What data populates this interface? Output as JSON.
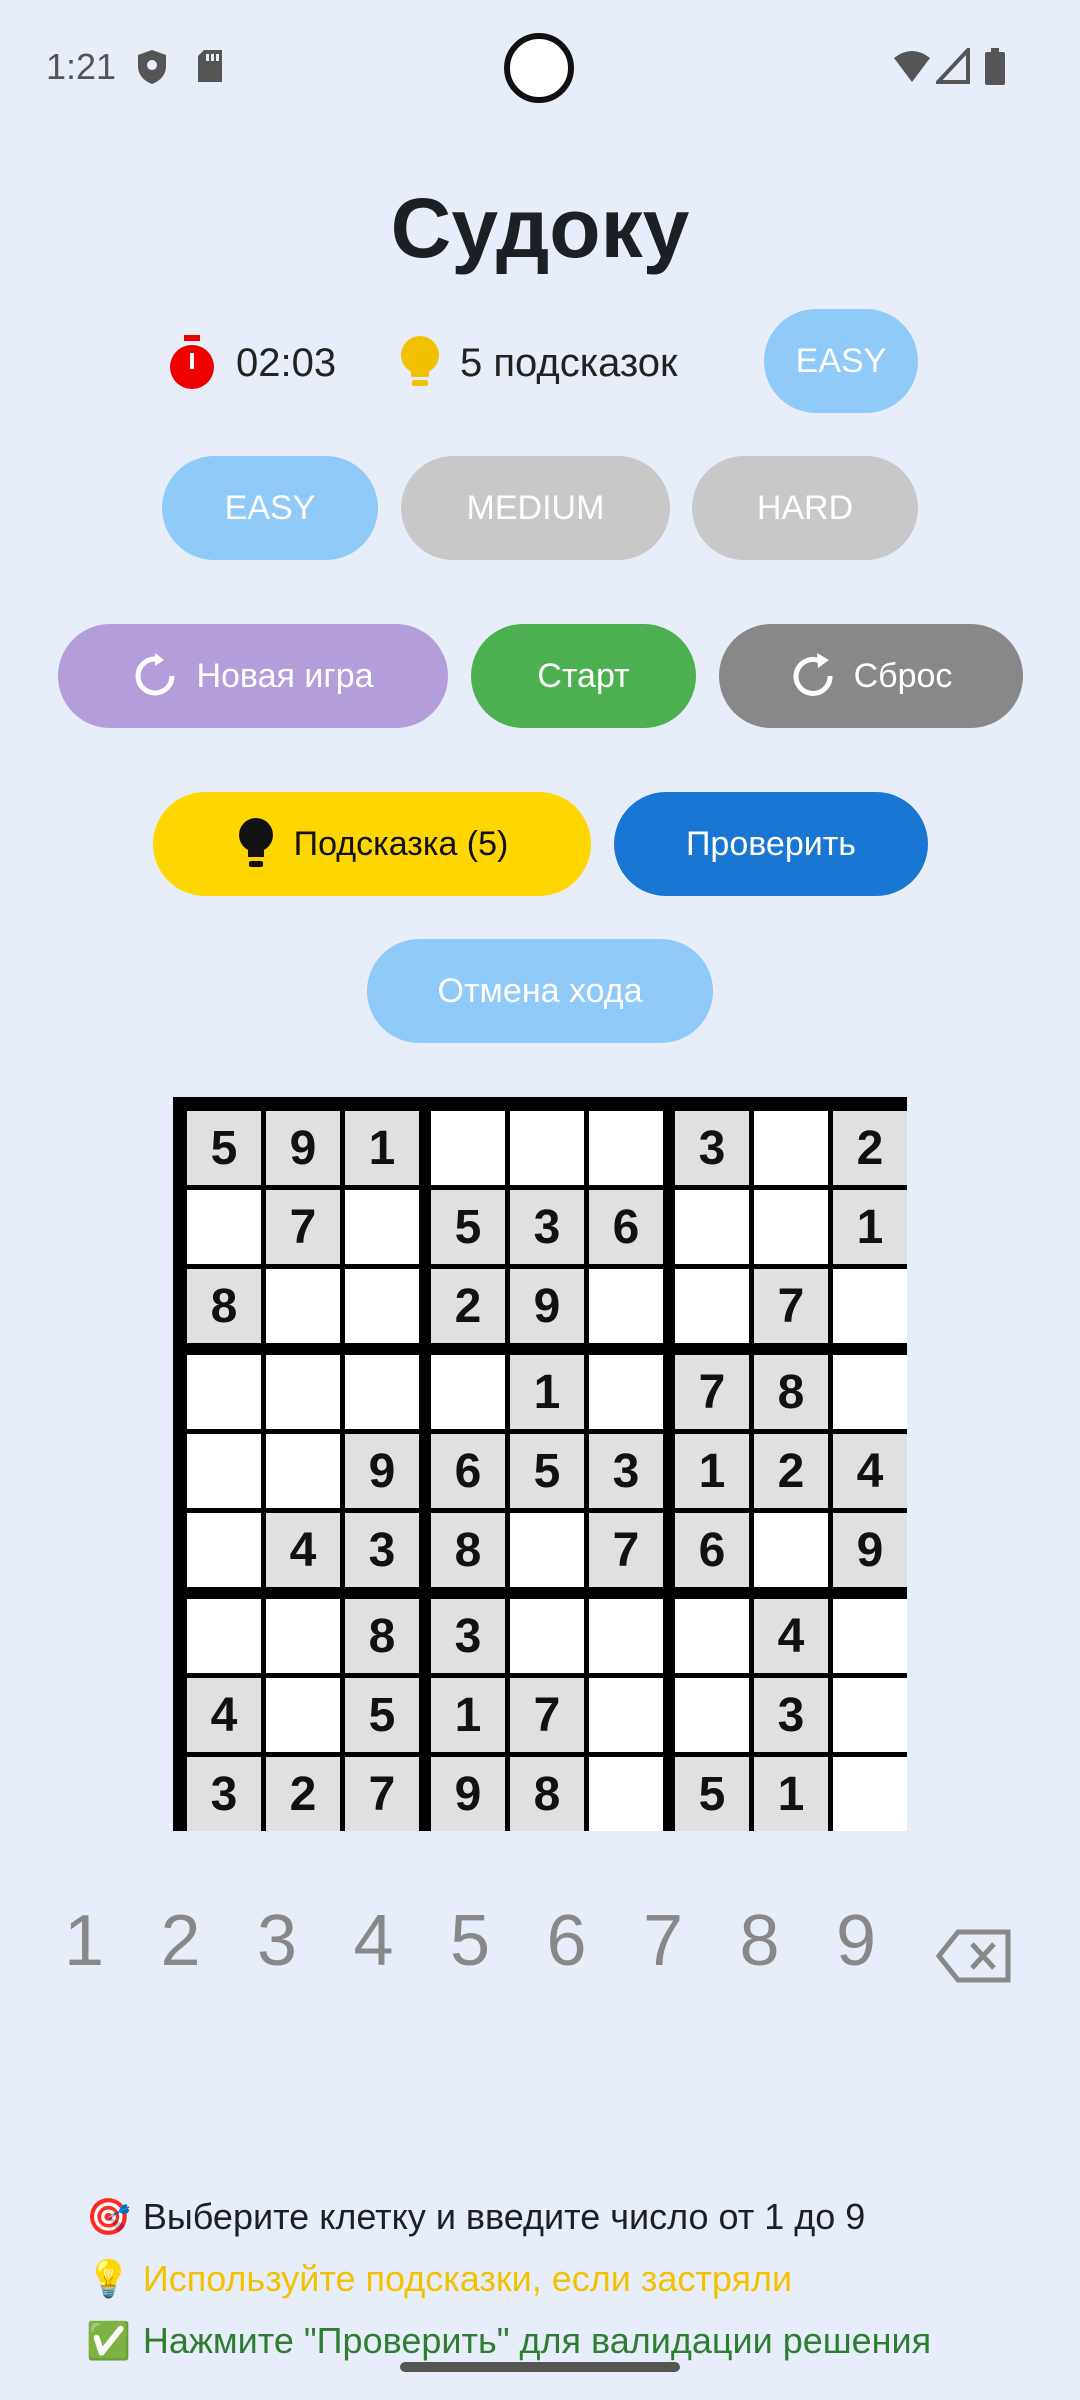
{
  "status": {
    "time": "1:21"
  },
  "title": "Судоку",
  "info": {
    "timer": "02:03",
    "hints_text": "5 подсказок",
    "difficulty_badge": "EASY"
  },
  "difficulty": [
    "EASY",
    "MEDIUM",
    "HARD"
  ],
  "actions": {
    "new_game": "Новая игра",
    "start": "Старт",
    "reset": "Сброс",
    "hint": "Подсказка (5)",
    "check": "Проверить",
    "undo": "Отмена хода"
  },
  "board": [
    [
      "5",
      "9",
      "1",
      "",
      "",
      "",
      "3",
      "",
      "2"
    ],
    [
      "",
      "7",
      "",
      "5",
      "3",
      "6",
      "",
      "",
      "1"
    ],
    [
      "8",
      "",
      "",
      "2",
      "9",
      "",
      "",
      "7",
      ""
    ],
    [
      "",
      "",
      "",
      "",
      "1",
      "",
      "7",
      "8",
      ""
    ],
    [
      "",
      "",
      "9",
      "6",
      "5",
      "3",
      "1",
      "2",
      "4"
    ],
    [
      "",
      "4",
      "3",
      "8",
      "",
      "7",
      "6",
      "",
      "9"
    ],
    [
      "",
      "",
      "8",
      "3",
      "",
      "",
      "",
      "4",
      ""
    ],
    [
      "4",
      "",
      "5",
      "1",
      "7",
      "",
      "",
      "3",
      ""
    ],
    [
      "3",
      "2",
      "7",
      "9",
      "8",
      "",
      "5",
      "1",
      ""
    ]
  ],
  "numpad": [
    "1",
    "2",
    "3",
    "4",
    "5",
    "6",
    "7",
    "8",
    "9"
  ],
  "hints": [
    {
      "icon": "🎯",
      "text": "Выберите клетку и введите число от 1 до 9",
      "color": "#1c1f24"
    },
    {
      "icon": "💡",
      "text": "Используйте подсказки, если застряли",
      "color": "#f2c200"
    },
    {
      "icon": "✅",
      "text": "Нажмите \"Проверить\" для валидации решения",
      "color": "#2e7d32"
    }
  ],
  "colors": {
    "easy": "#90caf9",
    "inactive": "#c8c8c8",
    "new_game": "#b39ddb",
    "start": "#4caf50",
    "reset": "#888888",
    "hint": "#ffd600",
    "check": "#1976d2",
    "undo": "#90caf9"
  }
}
